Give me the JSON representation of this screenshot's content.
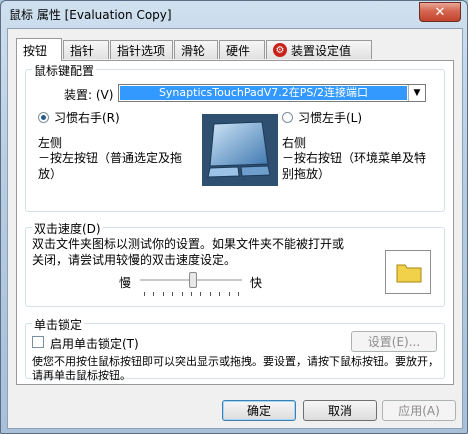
{
  "window": {
    "title": "鼠标 属性 [Evaluation Copy]",
    "close_glyph": "✕"
  },
  "tabs": [
    {
      "label": "按钮"
    },
    {
      "label": "指针"
    },
    {
      "label": "指针选项"
    },
    {
      "label": "滑轮"
    },
    {
      "label": "硬件"
    },
    {
      "label": "装置设定值",
      "icon": "synaptics-icon"
    }
  ],
  "button_config": {
    "legend": "鼠标键配置",
    "device_label": "装置: (V)",
    "device_value": "SynapticsTouchPadV7.2在PS/2连接端口",
    "right_hand_label": "习惯右手(R)",
    "left_hand_label": "习惯左手(L)",
    "left_side_title": "左侧",
    "left_side_desc": "－按左按钮（普通选定及拖放）",
    "right_side_title": "右侧",
    "right_side_desc": "－按右按钮（环境菜单及特别拖放）"
  },
  "double_click": {
    "legend": "双击速度(D)",
    "desc": "双击文件夹图标以测试你的设置。如果文件夹不能被打开或关闭，请尝试用较慢的双击速度设定。",
    "slow_label": "慢",
    "fast_label": "快",
    "speed_fraction": 0.52
  },
  "click_lock": {
    "legend": "单击锁定",
    "enable_label": "启用单击锁定(T)",
    "settings_label": "设置(E)...",
    "desc": "使您不用按住鼠标按钮即可以突出显示或拖拽。要设置，请按下鼠标按钮。要放开，请再单击鼠标按钮。"
  },
  "buttons": {
    "ok": "确定",
    "cancel": "取消",
    "apply": "应用(A)"
  },
  "colors": {
    "selection": "#3399ff",
    "folder": "#f2d14a"
  }
}
